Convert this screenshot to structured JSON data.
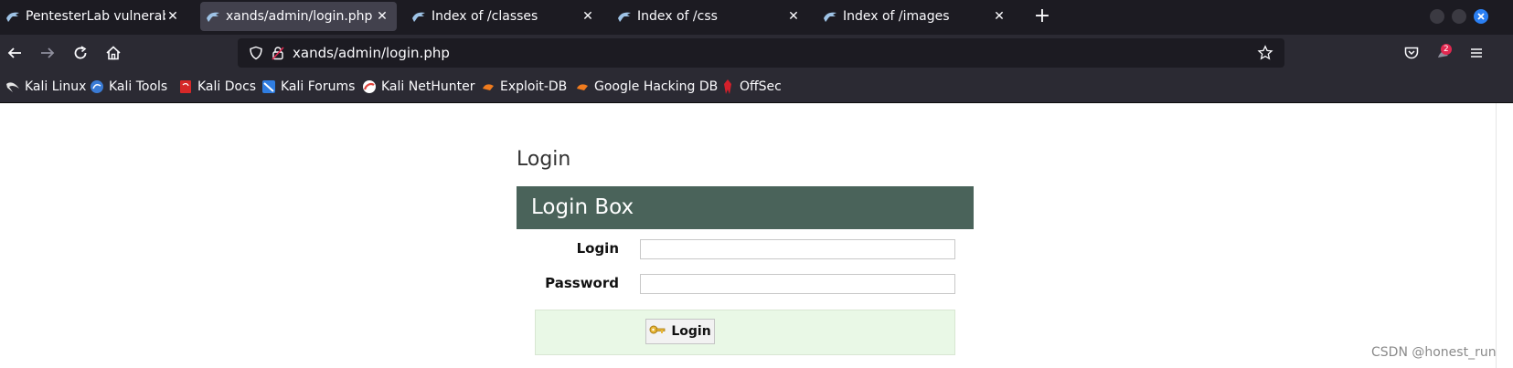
{
  "browser": {
    "tabs": [
      {
        "title": "PentesterLab vulnerable b",
        "active": false,
        "icon": "kali-dragon-icon"
      },
      {
        "title": "xands/admin/login.php",
        "active": true,
        "icon": "kali-dragon-icon"
      },
      {
        "title": "Index of /classes",
        "active": false,
        "icon": "kali-dragon-icon"
      },
      {
        "title": "Index of /css",
        "active": false,
        "icon": "kali-dragon-icon"
      },
      {
        "title": "Index of /images",
        "active": false,
        "icon": "kali-dragon-icon"
      }
    ],
    "url": "xands/admin/login.php",
    "extension_badge": "2",
    "bookmarks": [
      {
        "label": "Kali Linux",
        "icon": "kali-dragon-icon",
        "color": "#ffffff"
      },
      {
        "label": "Kali Tools",
        "icon": "kali-tools-icon",
        "color": "#3a7bd5"
      },
      {
        "label": "Kali Docs",
        "icon": "kali-docs-icon",
        "color": "#d62828"
      },
      {
        "label": "Kali Forums",
        "icon": "kali-forums-icon",
        "color": "#2f7de1"
      },
      {
        "label": "Kali NetHunter",
        "icon": "nethunter-icon",
        "color": "#e0443c"
      },
      {
        "label": "Exploit-DB",
        "icon": "exploit-db-icon",
        "color": "#f07b1e"
      },
      {
        "label": "Google Hacking DB",
        "icon": "ghdb-icon",
        "color": "#f07b1e"
      },
      {
        "label": "OffSec",
        "icon": "offsec-icon",
        "color": "#d4202b"
      }
    ]
  },
  "page": {
    "heading": "Login",
    "box_title": "Login Box",
    "login_label": "Login",
    "password_label": "Password",
    "login_value": "",
    "password_value": "",
    "submit_label": "Login"
  },
  "watermark": "CSDN @honest_run",
  "colors": {
    "box_header": "#4a635a",
    "actions_bg": "#e9f8e6"
  }
}
